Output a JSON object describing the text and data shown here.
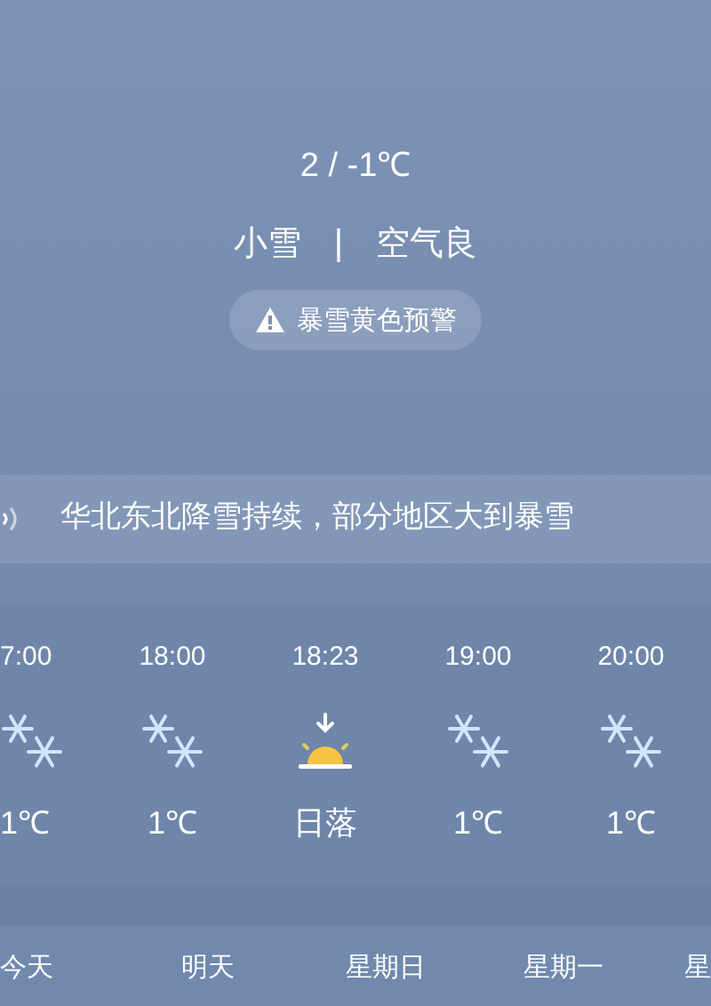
{
  "current": {
    "range": "2 / -1℃",
    "condition": "小雪",
    "separator": "|",
    "air_quality": "空气良",
    "alert": "暴雪黄色预警"
  },
  "news": {
    "headline": "华北东北降雪持续，部分地区大到暴雪"
  },
  "hourly": [
    {
      "time": "7:00",
      "kind": "snow",
      "value": "1℃"
    },
    {
      "time": "18:00",
      "kind": "snow",
      "value": "1℃"
    },
    {
      "time": "18:23",
      "kind": "sunset",
      "value": "日落"
    },
    {
      "time": "19:00",
      "kind": "snow",
      "value": "1℃"
    },
    {
      "time": "20:00",
      "kind": "snow",
      "value": "1℃"
    }
  ],
  "days": [
    {
      "label": "今天"
    },
    {
      "label": "明天"
    },
    {
      "label": "星期日"
    },
    {
      "label": "星期一"
    },
    {
      "label": "星"
    }
  ]
}
